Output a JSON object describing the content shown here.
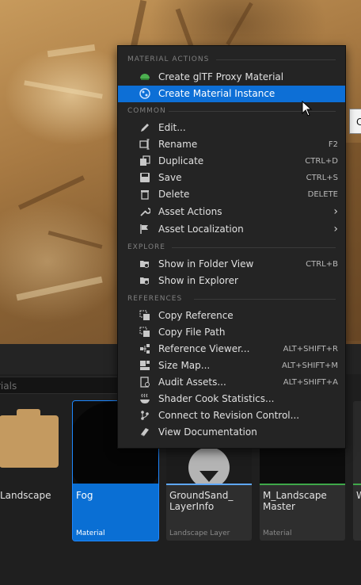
{
  "tooltip_stub": "C",
  "menu": {
    "sections": {
      "material_actions": "MATERIAL ACTIONS",
      "common": "COMMON",
      "explore": "EXPLORE",
      "references": "REFERENCES"
    },
    "items": {
      "create_gltf_proxy": {
        "label": "Create glTF Proxy Material",
        "icon": "gltf-icon"
      },
      "create_material_instance": {
        "label": "Create Material Instance",
        "icon": "material-instance-icon",
        "highlighted": true
      },
      "edit": {
        "label": "Edit...",
        "icon": "pencil-icon"
      },
      "rename": {
        "label": "Rename",
        "shortcut": "F2",
        "icon": "rename-icon"
      },
      "duplicate": {
        "label": "Duplicate",
        "shortcut": "CTRL+D",
        "icon": "duplicate-icon"
      },
      "save": {
        "label": "Save",
        "shortcut": "CTRL+S",
        "icon": "save-icon"
      },
      "delete": {
        "label": "Delete",
        "shortcut": "DELETE",
        "icon": "trash-icon"
      },
      "asset_actions": {
        "label": "Asset Actions",
        "icon": "wrench-icon",
        "submenu": true
      },
      "asset_localization": {
        "label": "Asset Localization",
        "icon": "flag-icon",
        "submenu": true
      },
      "show_folder_view": {
        "label": "Show in Folder View",
        "shortcut": "CTRL+B",
        "icon": "folder-search-icon"
      },
      "show_explorer": {
        "label": "Show in Explorer",
        "icon": "folder-search-icon"
      },
      "copy_reference": {
        "label": "Copy Reference",
        "icon": "copy-icon"
      },
      "copy_file_path": {
        "label": "Copy File Path",
        "icon": "copy-icon"
      },
      "reference_viewer": {
        "label": "Reference Viewer...",
        "shortcut": "ALT+SHIFT+R",
        "icon": "graph-icon"
      },
      "size_map": {
        "label": "Size Map...",
        "shortcut": "ALT+SHIFT+M",
        "icon": "sizemap-icon"
      },
      "audit_assets": {
        "label": "Audit Assets...",
        "shortcut": "ALT+SHIFT+A",
        "icon": "audit-icon"
      },
      "shader_cook_stats": {
        "label": "Shader Cook Statistics...",
        "icon": "steam-icon"
      },
      "connect_revision": {
        "label": "Connect to Revision Control...",
        "icon": "branch-icon"
      },
      "view_documentation": {
        "label": "View Documentation",
        "icon": "book-icon"
      }
    }
  },
  "browser": {
    "search_placeholder": "rials",
    "assets": [
      {
        "name": "Landscape",
        "type": "",
        "kind": "folder"
      },
      {
        "name": "Fog",
        "type": "Material",
        "selected": true
      },
      {
        "name": "GroundSand_\nLayerInfo",
        "type": "Landscape Layer"
      },
      {
        "name": "M_Landscape\nMaster",
        "type": "Material"
      },
      {
        "name": "W",
        "type": ""
      }
    ]
  },
  "colors": {
    "highlight": "#0d6fd6",
    "menu_bg": "#242424",
    "material_strip": "#3fa84a",
    "layer_strip": "#5ea8ff"
  }
}
